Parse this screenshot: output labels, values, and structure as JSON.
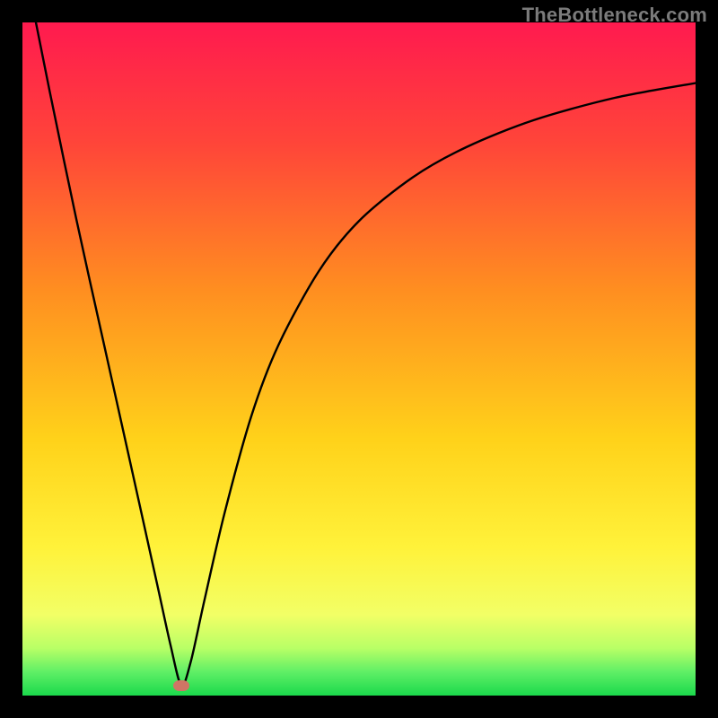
{
  "watermark": "TheBottleneck.com",
  "colors": {
    "frame": "#000000",
    "curve": "#000000",
    "marker": "#cf7565",
    "gradient_stops": [
      {
        "pos": 0.0,
        "color": "#ff1a4f"
      },
      {
        "pos": 0.18,
        "color": "#ff4539"
      },
      {
        "pos": 0.4,
        "color": "#ff8f20"
      },
      {
        "pos": 0.62,
        "color": "#ffd21a"
      },
      {
        "pos": 0.78,
        "color": "#fff23a"
      },
      {
        "pos": 0.88,
        "color": "#f2ff66"
      },
      {
        "pos": 0.93,
        "color": "#b8ff66"
      },
      {
        "pos": 0.965,
        "color": "#5fef66"
      },
      {
        "pos": 1.0,
        "color": "#1bd94c"
      }
    ]
  },
  "chart_data": {
    "type": "line",
    "title": "",
    "xlabel": "",
    "ylabel": "",
    "xlim": [
      0,
      100
    ],
    "ylim": [
      0,
      100
    ],
    "minimum_marker": {
      "x": 23.6,
      "y": 1.5
    },
    "series": [
      {
        "name": "bottleneck_curve",
        "points": [
          {
            "x": 2.0,
            "y": 100.0
          },
          {
            "x": 4.0,
            "y": 90.0
          },
          {
            "x": 8.0,
            "y": 70.8
          },
          {
            "x": 12.0,
            "y": 52.7
          },
          {
            "x": 16.0,
            "y": 34.7
          },
          {
            "x": 20.0,
            "y": 16.6
          },
          {
            "x": 22.0,
            "y": 7.5
          },
          {
            "x": 23.6,
            "y": 1.5
          },
          {
            "x": 25.0,
            "y": 5.0
          },
          {
            "x": 27.0,
            "y": 14.0
          },
          {
            "x": 30.0,
            "y": 27.0
          },
          {
            "x": 34.0,
            "y": 41.5
          },
          {
            "x": 38.0,
            "y": 52.0
          },
          {
            "x": 44.0,
            "y": 63.0
          },
          {
            "x": 50.0,
            "y": 70.5
          },
          {
            "x": 58.0,
            "y": 77.0
          },
          {
            "x": 66.0,
            "y": 81.5
          },
          {
            "x": 76.0,
            "y": 85.5
          },
          {
            "x": 88.0,
            "y": 88.8
          },
          {
            "x": 100.0,
            "y": 91.0
          }
        ]
      }
    ]
  }
}
